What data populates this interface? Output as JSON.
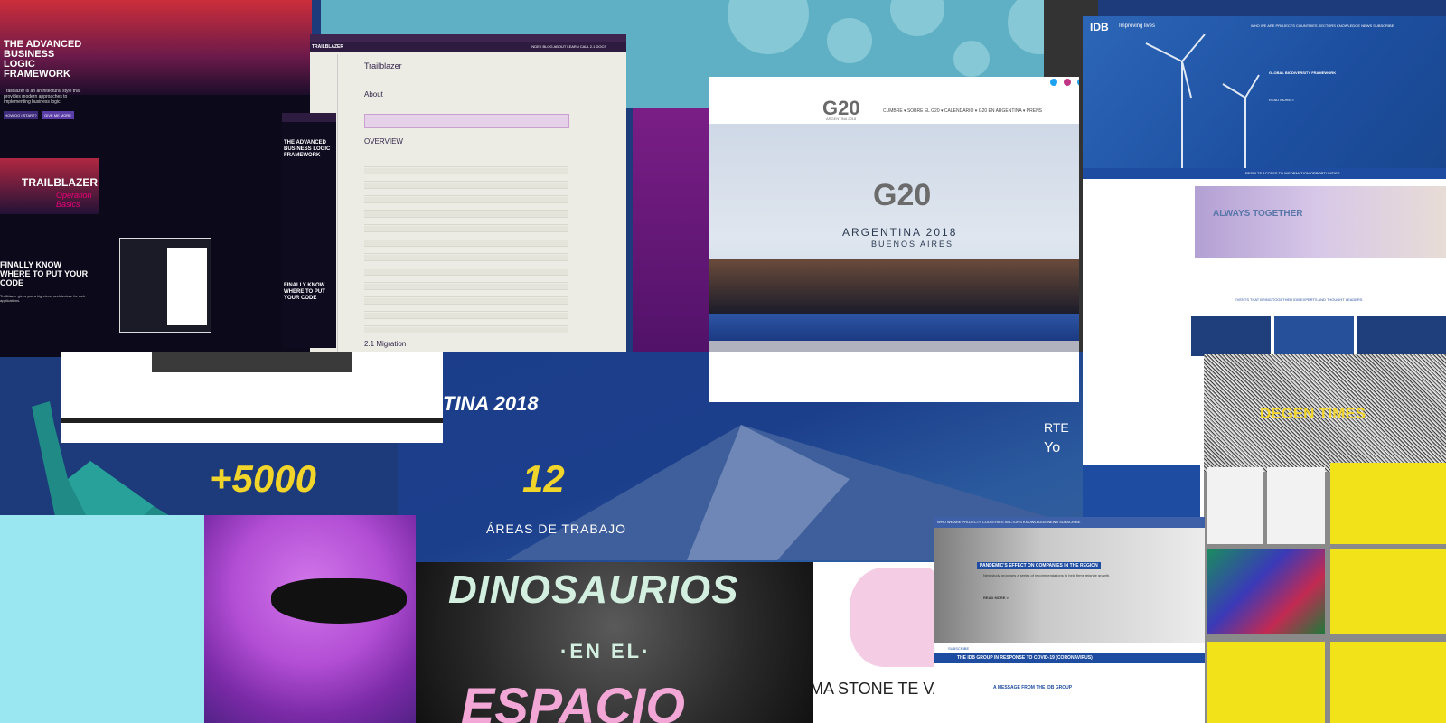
{
  "trailblazer": {
    "hero_title": "THE ADVANCED BUSINESS LOGIC FRAMEWORK",
    "hero_sub": "Trailblazer is an architectural style that provides modern approaches to implementing business logic.",
    "btn_start": "HOW DO I START?",
    "btn_more": "GIVE ME MORE",
    "video_title": "TRAILBLAZER",
    "video_sub": "Operation Basics",
    "know_title": "FINALLY KNOW WHERE TO PUT YOUR CODE",
    "know_text": "Trailblazer gives you a high-level architecture for web applications.",
    "doc_brand": "TRAILBLAZER",
    "doc_nav": "INDEX  BLOG  ABOUT  LEARN  CALL  2.1 DOCS",
    "doc_title": "Trailblazer",
    "doc_about": "About",
    "doc_overview": "OVERVIEW",
    "doc_migration": "2.1 Migration",
    "mobile_title": "THE ADVANCED BUSINESS LOGIC FRAMEWORK",
    "mobile_know": "FINALLY KNOW WHERE TO PUT YOUR CODE"
  },
  "g20": {
    "logo": "G20",
    "logo_sub": "ARGENTINA 2018",
    "menu": "CUMBRE ▾   SOBRE EL G20 ▾   CALENDARIO ▾   G20 EN ARGENTINA ▾   PRENS",
    "banner_logo": "G20",
    "banner_title": "ARGENTINA 2018",
    "banner_city": "BUENOS AIRES",
    "social_colors": [
      "#1da1f2",
      "#c13584",
      "#1da1f2"
    ]
  },
  "idb": {
    "brand": "IDB",
    "tagline": "Improving lives",
    "links": "WHO WE ARE   PROJECTS   COUNTRIES   SECTORS   KNOWLEDGE   NEWS   SUBSCRIBE",
    "hero_label": "GLOBAL BIODIVERSITY FRAMEWORK",
    "read_more": "READ MORE >",
    "subnav": "RESULTS      ACCESS TO INFORMATION      OPPORTUNITIES",
    "always": "ALWAYS TOGETHER",
    "events": "EVENTS THAT BRING TOGETHER IDB EXPERTS AND THOUGHT LEADERS"
  },
  "idb_bottom": {
    "top": "WHO WE ARE   PROJECTS   COUNTRIES   SECTORS   KNOWLEDGE   NEWS   SUBSCRIBE",
    "label": "PANDEMIC'S EFFECT ON COMPANIES IN THE REGION",
    "desc": "New study proposes a series of recommendations to help firms reignite growth.",
    "read_more": "READ MORE >",
    "subscribe": "SUBSCRIBE",
    "strip": "THE IDB GROUP IN RESPONSE TO COVID-19 (CORONAVIRUS)",
    "message": "A MESSAGE FROM THE IDB GROUP"
  },
  "degen": {
    "title": "DEGEN TIMES"
  },
  "stats": {
    "stat1": "+5000",
    "stat2": "12",
    "areas": "ÁREAS DE TRABAJO",
    "arg": "TINA 2018",
    "corte": "RTE",
    "corte2": "Yo"
  },
  "dinos": {
    "line1": "DINOSAURIOS",
    "line2": "·EN EL·",
    "line3": "ESPACIO"
  },
  "emma": {
    "text": "MA STONE TE VA"
  },
  "colors": {
    "yellow": "#f2d52a",
    "idb_blue": "#1e4ca0",
    "purple": "#3d2550"
  }
}
